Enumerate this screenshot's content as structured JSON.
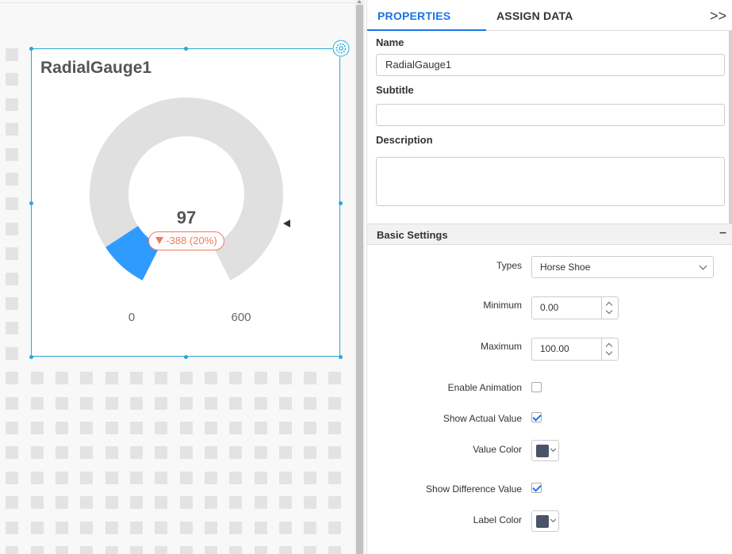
{
  "widget": {
    "title": "RadialGauge1",
    "actual_value": "97",
    "difference_label": "-388 (20%)",
    "min_label": "0",
    "max_label": "600",
    "fill_fraction": 0.1617,
    "colors": {
      "fill": "#2f9bff",
      "track": "#e0e0e0",
      "difference": "#f07a5c",
      "border": "#2aa6d9"
    }
  },
  "panel": {
    "tabs": [
      {
        "label": "PROPERTIES",
        "active": true
      },
      {
        "label": "ASSIGN DATA",
        "active": false
      }
    ],
    "collapse_icon": ">>",
    "name_label": "Name",
    "name_value": "RadialGauge1",
    "subtitle_label": "Subtitle",
    "subtitle_value": "",
    "description_label": "Description",
    "basic_settings": {
      "title": "Basic Settings",
      "collapse_symbol": "–",
      "types_label": "Types",
      "types_value": "Horse Shoe",
      "minimum_label": "Minimum",
      "minimum_value": "0.00",
      "maximum_label": "Maximum",
      "maximum_value": "100.00",
      "enable_animation_label": "Enable Animation",
      "enable_animation_checked": false,
      "show_actual_value_label": "Show Actual Value",
      "show_actual_value_checked": true,
      "value_color_label": "Value Color",
      "value_color": "#4a5468",
      "show_difference_value_label": "Show Difference Value",
      "show_difference_value_checked": true,
      "label_color_label": "Label Color",
      "label_color": "#4a5468"
    }
  }
}
